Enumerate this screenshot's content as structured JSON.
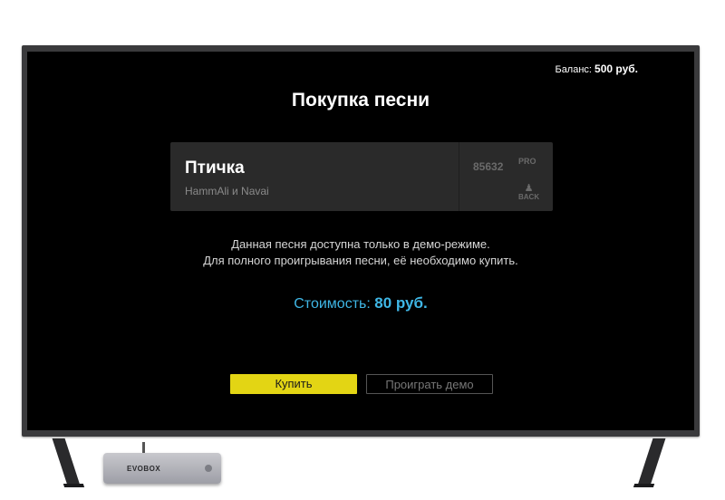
{
  "balance": {
    "label": "Баланс:",
    "value": "500 руб."
  },
  "title": "Покупка песни",
  "song": {
    "title": "Птичка",
    "artist": "HammAli и Navai",
    "number": "85632",
    "badges": {
      "pro": "PRO",
      "back": "BACK"
    }
  },
  "notice": {
    "line1": "Данная песня доступна только в демо-режиме.",
    "line2": "Для полного проигрывания песни, её необходимо купить."
  },
  "price": {
    "label": "Стоимость:",
    "value": "80 руб."
  },
  "buttons": {
    "buy": "Купить",
    "demo": "Проиграть демо"
  },
  "device": {
    "logo": "EVOBOX"
  },
  "colors": {
    "accent_yellow": "#e3d514",
    "price_blue": "#3fb7e6",
    "background": "#000000"
  }
}
